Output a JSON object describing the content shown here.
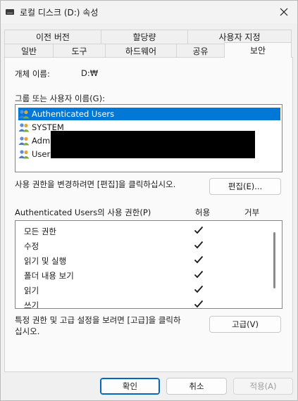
{
  "window": {
    "title": "로컬 디스크 (D:) 속성"
  },
  "tabs_back": [
    "이전 버전",
    "할당량",
    "사용자 지정"
  ],
  "tabs_front": [
    "일반",
    "도구",
    "하드웨어",
    "공유",
    "보안"
  ],
  "object": {
    "label": "개체 이름:",
    "value": "D:₩"
  },
  "groups": {
    "label": "그룹 또는 사용자 이름(G):",
    "items": [
      "Authenticated Users",
      "SYSTEM",
      "Adm",
      "Users"
    ]
  },
  "edit": {
    "hint": "사용 권한을 변경하려면 [편집]을 클릭하십시오.",
    "button": "편집(E)..."
  },
  "permissions": {
    "header": "Authenticated Users의 사용 권한(P)",
    "allow": "허용",
    "deny": "거부",
    "items": [
      {
        "name": "모든 권한",
        "allow": true,
        "deny": false
      },
      {
        "name": "수정",
        "allow": true,
        "deny": false
      },
      {
        "name": "읽기 및 실행",
        "allow": true,
        "deny": false
      },
      {
        "name": "폴더 내용 보기",
        "allow": true,
        "deny": false
      },
      {
        "name": "읽기",
        "allow": true,
        "deny": false
      },
      {
        "name": "쓰기",
        "allow": true,
        "deny": false
      }
    ]
  },
  "advanced": {
    "hint_line1": "특정 권한 및 고급 설정을 보려면 [고급]을 클릭하",
    "hint_line2": "십시오.",
    "button": "고급(V)"
  },
  "footer": {
    "ok": "확인",
    "cancel": "취소",
    "apply": "적용(A)"
  },
  "colors": {
    "selection": "#0078d7",
    "primary_border": "#0067c0"
  }
}
